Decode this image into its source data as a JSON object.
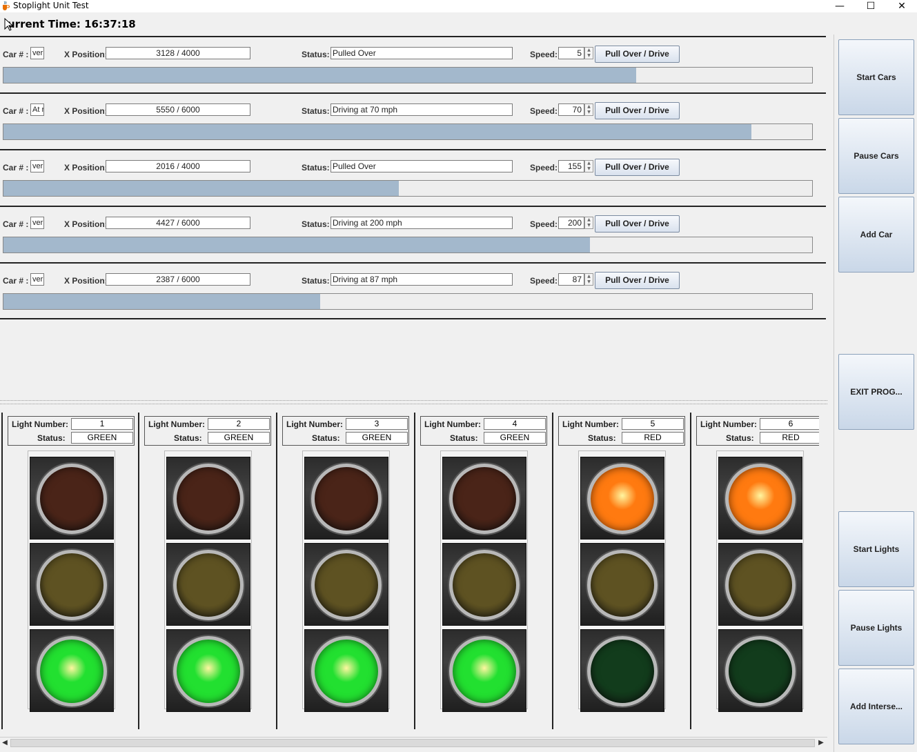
{
  "window": {
    "title": "Stoplight Unit Test",
    "minimize_glyph": "—",
    "maximize_glyph": "☐",
    "close_glyph": "✕"
  },
  "time": {
    "label": "urrent Time: 16:37:18"
  },
  "car_labels": {
    "car_num": "Car # :",
    "x_position": "X Position:",
    "status": "Status:",
    "speed": "Speed:",
    "button": "Pull Over / Drive"
  },
  "cars": [
    {
      "car_num": "ver",
      "x_position": "3128 / 4000",
      "status": "Pulled Over",
      "speed": "5",
      "progress": 0.782
    },
    {
      "car_num": "At r",
      "x_position": "5550 / 6000",
      "status": "Driving at 70 mph",
      "speed": "70",
      "progress": 0.925
    },
    {
      "car_num": "ver",
      "x_position": "2016 / 4000",
      "status": "Pulled Over",
      "speed": "155",
      "progress": 0.489
    },
    {
      "car_num": "ver",
      "x_position": "4427 / 6000",
      "status": "Driving at 200 mph",
      "speed": "200",
      "progress": 0.725
    },
    {
      "car_num": "ver",
      "x_position": "2387 / 6000",
      "status": "Driving at 87 mph",
      "speed": "87",
      "progress": 0.392
    }
  ],
  "light_labels": {
    "number": "Light Number:",
    "status": "Status:"
  },
  "lights": [
    {
      "number": "1",
      "status": "GREEN"
    },
    {
      "number": "2",
      "status": "GREEN"
    },
    {
      "number": "3",
      "status": "GREEN"
    },
    {
      "number": "4",
      "status": "GREEN"
    },
    {
      "number": "5",
      "status": "RED"
    },
    {
      "number": "6",
      "status": "RED"
    }
  ],
  "side_buttons": {
    "start_cars": "Start Cars",
    "pause_cars": "Pause Cars",
    "add_car": "Add Car",
    "exit": "EXIT PROG...",
    "start_lights": "Start Lights",
    "pause_lights": "Pause Lights",
    "add_intersection": "Add Interse..."
  },
  "colors": {
    "progress_fill": "#a3b8cc",
    "red_on": "#ff7a10",
    "red_off": "#4a2418",
    "yellow_off": "#5e5222",
    "green_on": "#22e030",
    "green_off": "#123c1c"
  },
  "icons": {
    "app_icon": "java-cup-icon",
    "scroll_left": "◀",
    "scroll_right": "▶"
  }
}
